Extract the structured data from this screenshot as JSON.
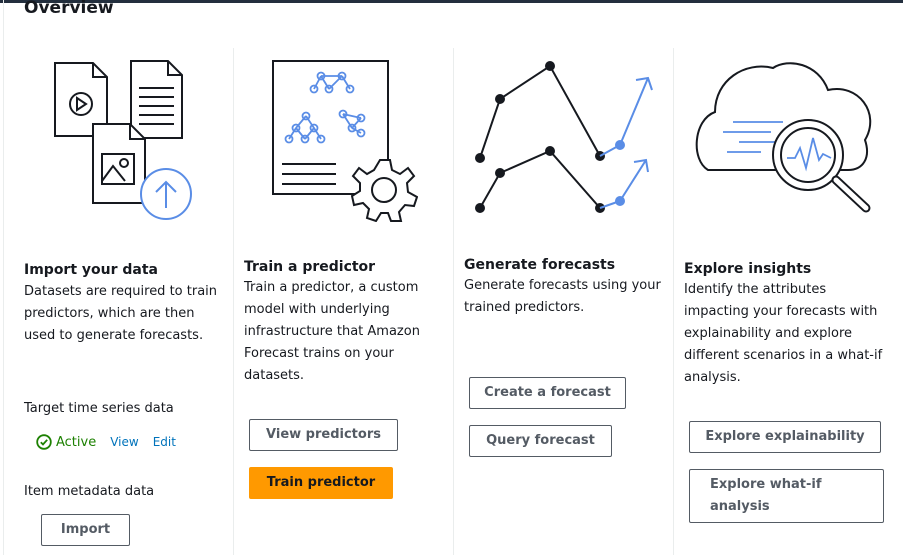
{
  "page": {
    "title": "Overview"
  },
  "columns": [
    {
      "heading": "Import your data",
      "description": "Datasets are required to train predictors, which are then used to generate forecasts.",
      "target_label": "Target time series data",
      "status_text": "Active",
      "view_link": "View",
      "edit_link": "Edit",
      "metadata_label": "Item metadata data",
      "import_button": "Import"
    },
    {
      "heading": "Train a predictor",
      "description": "Train a predictor, a custom model with underlying infrastructure that Amazon Forecast trains on your datasets.",
      "view_button": "View predictors",
      "train_button": "Train predictor"
    },
    {
      "heading": "Generate forecasts",
      "description": "Generate forecasts using your trained predictors.",
      "create_button": "Create a forecast",
      "query_button": "Query forecast"
    },
    {
      "heading": "Explore insights",
      "description": "Identify the attributes impacting your forecasts with explainability and explore different scenarios in a what-if analysis.",
      "explain_button": "Explore explainability",
      "whatif_button": "Explore what-if analysis"
    }
  ],
  "colors": {
    "accent_blue": "#5a8de6",
    "primary_orange": "#ff9900",
    "link_blue": "#0073bb",
    "status_green": "#1d8102"
  },
  "icons": [
    "video-file-icon",
    "document-icon",
    "image-file-icon",
    "upload-icon",
    "network-document-icon",
    "gear-icon",
    "line-graph-icon",
    "cloud-magnifier-icon",
    "check-circle-icon"
  ]
}
